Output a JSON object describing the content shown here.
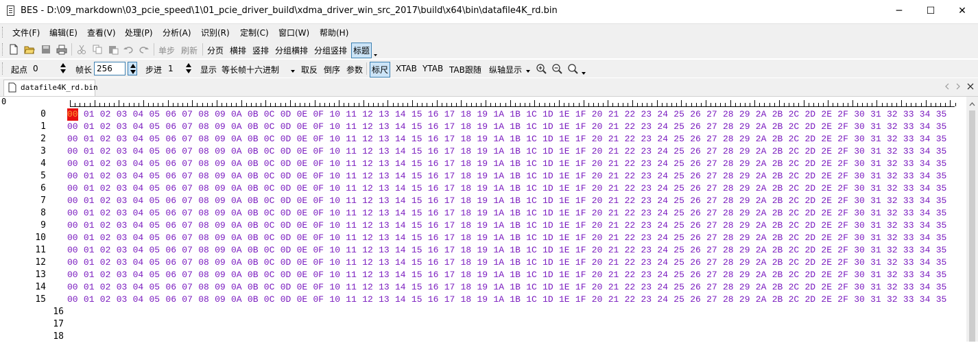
{
  "window": {
    "title": "BES - D:\\09_markdown\\03_pcie_speed\\1\\01_pcie_driver_build\\xdma_driver_win_src_2017\\build\\x64\\bin\\datafile4K_rd.bin",
    "minimize": "─",
    "maximize": "☐",
    "close": "✕"
  },
  "menu": [
    "文件(F)",
    "编辑(E)",
    "查看(V)",
    "处理(P)",
    "分析(A)",
    "识别(R)",
    "定制(C)",
    "窗口(W)",
    "帮助(H)"
  ],
  "toolbar1": {
    "step": "单步",
    "refresh": "刷新",
    "page": "分页",
    "horizontal": "横排",
    "vertical": "竖排",
    "group_horizontal": "分组横排",
    "group_vertical": "分组竖排",
    "header": "标题"
  },
  "toolbar2": {
    "start_label": "起点",
    "start_value": "0",
    "frame_len_label": "帧长",
    "frame_len_value": "256",
    "step_label": "步进",
    "step_value": "1",
    "display_label": "显示",
    "display_mode": "等长帧十六进制",
    "invert": "取反",
    "reverse": "倒序",
    "params": "参数",
    "ruler": "标尺",
    "xtab": "XTAB",
    "ytab": "YTAB",
    "tab_follow": "TAB跟随",
    "axis_display": "纵轴显示"
  },
  "tabs": [
    {
      "label": "datafile4K_rd.bin"
    }
  ],
  "editor": {
    "corner_label": "0",
    "rows_with_data": [
      "0",
      "1",
      "2",
      "3",
      "4",
      "5",
      "6",
      "7",
      "8",
      "9",
      "10",
      "11",
      "12",
      "13",
      "14",
      "15"
    ],
    "empty_rows": [
      "16",
      "17",
      "18"
    ],
    "bytes": [
      "00",
      "01",
      "02",
      "03",
      "04",
      "05",
      "06",
      "07",
      "08",
      "09",
      "0A",
      "0B",
      "0C",
      "0D",
      "0E",
      "0F",
      "10",
      "11",
      "12",
      "13",
      "14",
      "15",
      "16",
      "17",
      "18",
      "19",
      "1A",
      "1B",
      "1C",
      "1D",
      "1E",
      "1F",
      "20",
      "21",
      "22",
      "23",
      "24",
      "25",
      "26",
      "27",
      "28",
      "29",
      "2A",
      "2B",
      "2C",
      "2D",
      "2E",
      "2F",
      "30",
      "31",
      "32",
      "33",
      "34",
      "35"
    ],
    "selected_row": 0,
    "selected_col": 0
  },
  "colors": {
    "byte_text": "#7a1bbf",
    "selection_bg": "#e81010",
    "selection_text": "#ff9a30",
    "toolbar_bg": "#f0f0f0"
  }
}
